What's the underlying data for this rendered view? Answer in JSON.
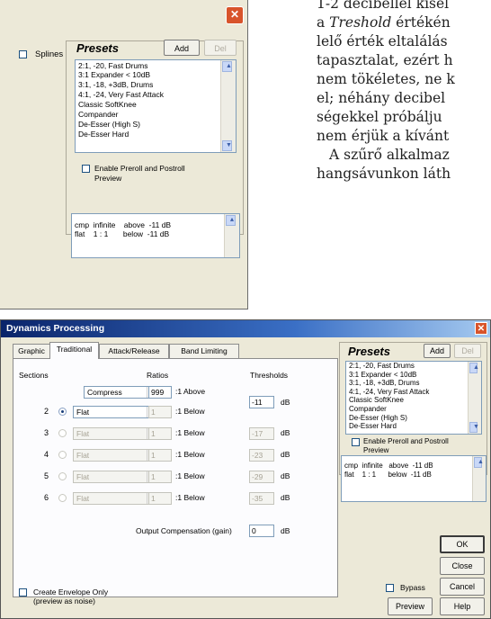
{
  "article": {
    "lines": [
      "1-2 decibellel kisel",
      "a ",
      "Treshold",
      " értékén",
      "lelő érték eltalálás",
      "tapasztalat, ezért h",
      "nem tökéletes, ne k",
      "el; néhány decibel",
      "ségekkel próbálju",
      "nem érjük a kívánt",
      "A szűrő alkalmaz",
      "hangsávunkon láth"
    ]
  },
  "back_dialog": {
    "close_glyph": "✕",
    "splines_label": "Splines",
    "presets_title": "Presets",
    "add_label": "Add",
    "del_label": "Del",
    "presets": [
      "2:1, -20, Fast Drums",
      "3:1 Expander < 10dB",
      "3:1, -18, +3dB, Drums",
      "4:1, -24, Very Fast Attack",
      "Classic SoftKnee",
      "Compander",
      "De-Esser (High S)",
      "De-Esser Hard"
    ],
    "preroll_label_1": "Enable Preroll and Postroll",
    "preroll_label_2": "Preview",
    "info_line1": "cmp  infinite    above  -11 dB",
    "info_line2": "flat    1 : 1       below  -11 dB"
  },
  "front_dialog": {
    "title": "Dynamics Processing",
    "close_glyph": "✕",
    "tabs": [
      "Graphic",
      "Traditional",
      "Attack/Release",
      "Band Limiting"
    ],
    "sections_label": "Sections",
    "ratios_label": "Ratios",
    "thresholds_label": "Thresholds",
    "rows": [
      {
        "num": "",
        "mode": "Compress",
        "ratio": "999",
        "suffix": ":1 Above",
        "threshold": "-11",
        "db": "dB"
      },
      {
        "num": "2",
        "mode": "Flat",
        "ratio": "1",
        "suffix": ":1 Below",
        "threshold": "",
        "db": "dB"
      },
      {
        "num": "3",
        "mode": "Flat",
        "ratio": "1",
        "suffix": ":1 Below",
        "threshold": "-17",
        "db": "dB"
      },
      {
        "num": "4",
        "mode": "Flat",
        "ratio": "1",
        "suffix": ":1 Below",
        "threshold": "-23",
        "db": "dB"
      },
      {
        "num": "5",
        "mode": "Flat",
        "ratio": "1",
        "suffix": ":1 Below",
        "threshold": "-29",
        "db": "dB"
      },
      {
        "num": "6",
        "mode": "Flat",
        "ratio": "1",
        "suffix": ":1 Below",
        "threshold": "-35",
        "db": "dB"
      }
    ],
    "output_comp_label": "Output Compensation (gain)",
    "output_comp_value": "0",
    "output_comp_db": "dB",
    "envelope_label_1": "Create Envelope Only",
    "envelope_label_2": "(preview as noise)",
    "presets_title": "Presets",
    "add_label": "Add",
    "del_label": "Del",
    "presets": [
      "2:1, -20, Fast Drums",
      "3:1 Expander < 10dB",
      "3:1, -18, +3dB, Drums",
      "4:1, -24, Very Fast Attack",
      "Classic SoftKnee",
      "Compander",
      "De-Esser (High S)",
      "De-Esser Hard"
    ],
    "preroll_label_1": "Enable Preroll and Postroll",
    "preroll_label_2": "Preview",
    "info_line1": "cmp  infinite   above  -11 dB",
    "info_line2": "flat    1 : 1      below  -11 dB",
    "ok_label": "OK",
    "close_label": "Close",
    "cancel_label": "Cancel",
    "bypass_label": "Bypass",
    "preview_label": "Preview",
    "help_label": "Help"
  }
}
